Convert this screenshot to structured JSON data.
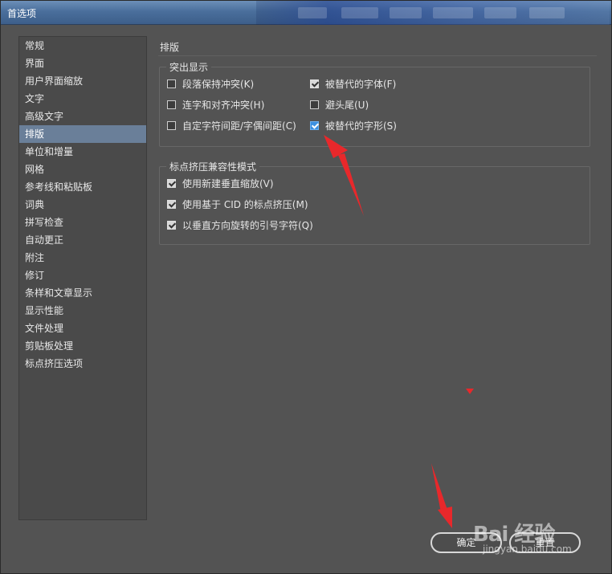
{
  "window": {
    "title": "首选项"
  },
  "nav": {
    "items": [
      "常规",
      "界面",
      "用户界面缩放",
      "文字",
      "高级文字",
      "排版",
      "单位和增量",
      "网格",
      "参考线和粘贴板",
      "词典",
      "拼写检查",
      "自动更正",
      "附注",
      "修订",
      "条样和文章显示",
      "显示性能",
      "文件处理",
      "剪贴板处理",
      "标点挤压选项"
    ],
    "active_index": 5
  },
  "content": {
    "section_title": "排版",
    "highlight_group": {
      "legend": "突出显示",
      "options": [
        {
          "label": "段落保持冲突(K)",
          "checked": false
        },
        {
          "label": "被替代的字体(F)",
          "checked": true
        },
        {
          "label": "连字和对齐冲突(H)",
          "checked": false
        },
        {
          "label": "避头尾(U)",
          "checked": false
        },
        {
          "label": "自定字符间距/字偶间距(C)",
          "checked": false
        },
        {
          "label": "被替代的字形(S)",
          "checked": true,
          "focused": true
        }
      ]
    },
    "compat_group": {
      "legend": "标点挤压兼容性模式",
      "options": [
        {
          "label": "使用新建垂直缩放(V)",
          "checked": true
        },
        {
          "label": "使用基于 CID 的标点挤压(M)",
          "checked": true
        },
        {
          "label": "以垂直方向旋转的引号字符(Q)",
          "checked": true
        }
      ]
    }
  },
  "buttons": {
    "ok": "确定",
    "reset": "重置"
  },
  "watermark": {
    "main": "Bai 经验",
    "sub": "jingyan.baidu.com"
  },
  "colors": {
    "active_nav": "#6a7f99",
    "annotation_arrow": "#e8282b",
    "checkbox_focus": "#3b8fe0"
  }
}
